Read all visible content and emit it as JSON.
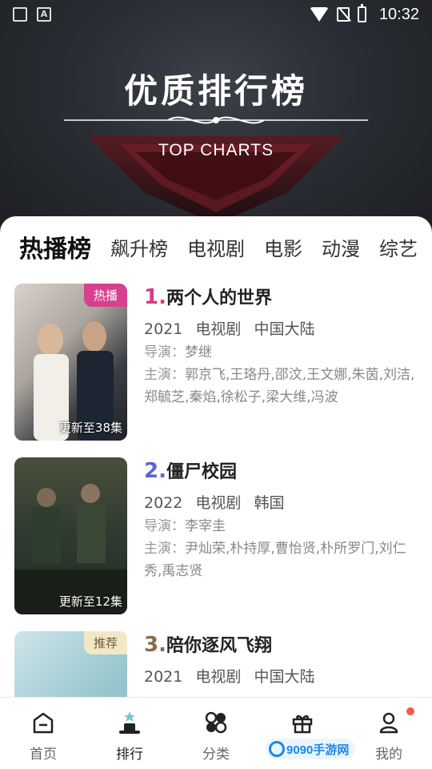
{
  "status_bar": {
    "time": "10:32"
  },
  "header": {
    "title": "优质排行榜",
    "subtitle": "TOP CHARTS"
  },
  "tabs": [
    "热播榜",
    "飙升榜",
    "电视剧",
    "电影",
    "动漫",
    "综艺"
  ],
  "items": [
    {
      "rank": "1.",
      "title": "两个人的世界",
      "year": "2021",
      "genre": "电视剧",
      "region": "中国大陆",
      "director_label": "导演：",
      "director": "梦继",
      "cast_label": "主演：",
      "cast": "郭京飞,王珞丹,邵汶,王文娜,朱茵,刘洁,郑毓芝,秦焰,徐松子,梁大维,冯波",
      "badge": "热播",
      "update": "更新至38集",
      "rank_color": "#d63a8a",
      "badge_color": "#d6408e"
    },
    {
      "rank": "2.",
      "title": "僵尸校园",
      "year": "2022",
      "genre": "电视剧",
      "region": "韩国",
      "director_label": "导演：",
      "director": "李宰圭",
      "cast_label": "主演：",
      "cast": "尹灿荣,朴持厚,曹怡贤,朴所罗门,刘仁秀,禹志贤",
      "update": "更新至12集",
      "rank_color": "#5a64d8"
    },
    {
      "rank": "3.",
      "title": "陪你逐风飞翔",
      "year": "2021",
      "genre": "电视剧",
      "region": "中国大陆",
      "badge": "推荐",
      "rank_color": "#8a6a4a",
      "badge_color": "#f3e8c6"
    }
  ],
  "bottom_nav": [
    {
      "label": "首页",
      "icon": "home-icon"
    },
    {
      "label": "排行",
      "icon": "ranking-icon"
    },
    {
      "label": "分类",
      "icon": "category-icon"
    },
    {
      "label": "",
      "icon": "gift-icon"
    },
    {
      "label": "我的",
      "icon": "profile-icon"
    }
  ],
  "watermark": "9090手游网"
}
